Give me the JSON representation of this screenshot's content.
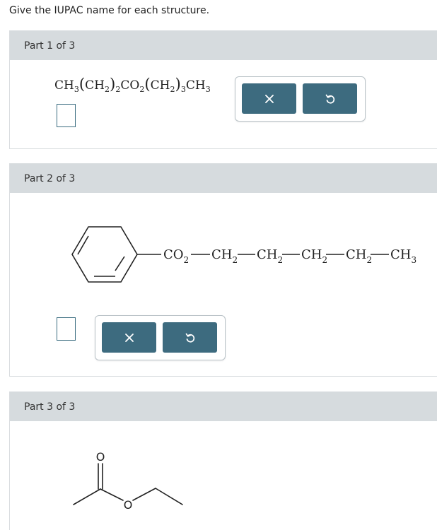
{
  "instruction": "Give the IUPAC name for each structure.",
  "parts": [
    {
      "label": "Part 1 of 3",
      "answer_value": ""
    },
    {
      "label": "Part 2 of 3",
      "answer_value": ""
    },
    {
      "label": "Part 3 of 3"
    }
  ],
  "part1_formula": {
    "ch3": "CH",
    "sub3": "3",
    "lp1": "(",
    "ch2a": "CH",
    "sub2a": "2",
    "rp1": ")",
    "n1": "2",
    "co2": "CO",
    "sub2b": "2",
    "lp2": "(",
    "ch2b": "CH",
    "sub2c": "2",
    "rp2": ")",
    "n2": "3",
    "ch3b": "CH",
    "sub3b": "3"
  },
  "part2_chain": {
    "co2": "CO",
    "co2_sub": "2",
    "c1": "CH",
    "c1_sub": "2",
    "c2": "CH",
    "c2_sub": "2",
    "c3": "CH",
    "c3_sub": "2",
    "c4": "CH",
    "c4_sub": "2",
    "c5": "CH",
    "c5_sub": "3"
  },
  "part3_atoms": {
    "carbonyl_o": "O",
    "ester_o": "O"
  },
  "icons": {
    "clear": "x-icon",
    "reset": "undo-icon"
  },
  "colors": {
    "button": "#3d6b7f",
    "header": "#d6dbde"
  }
}
